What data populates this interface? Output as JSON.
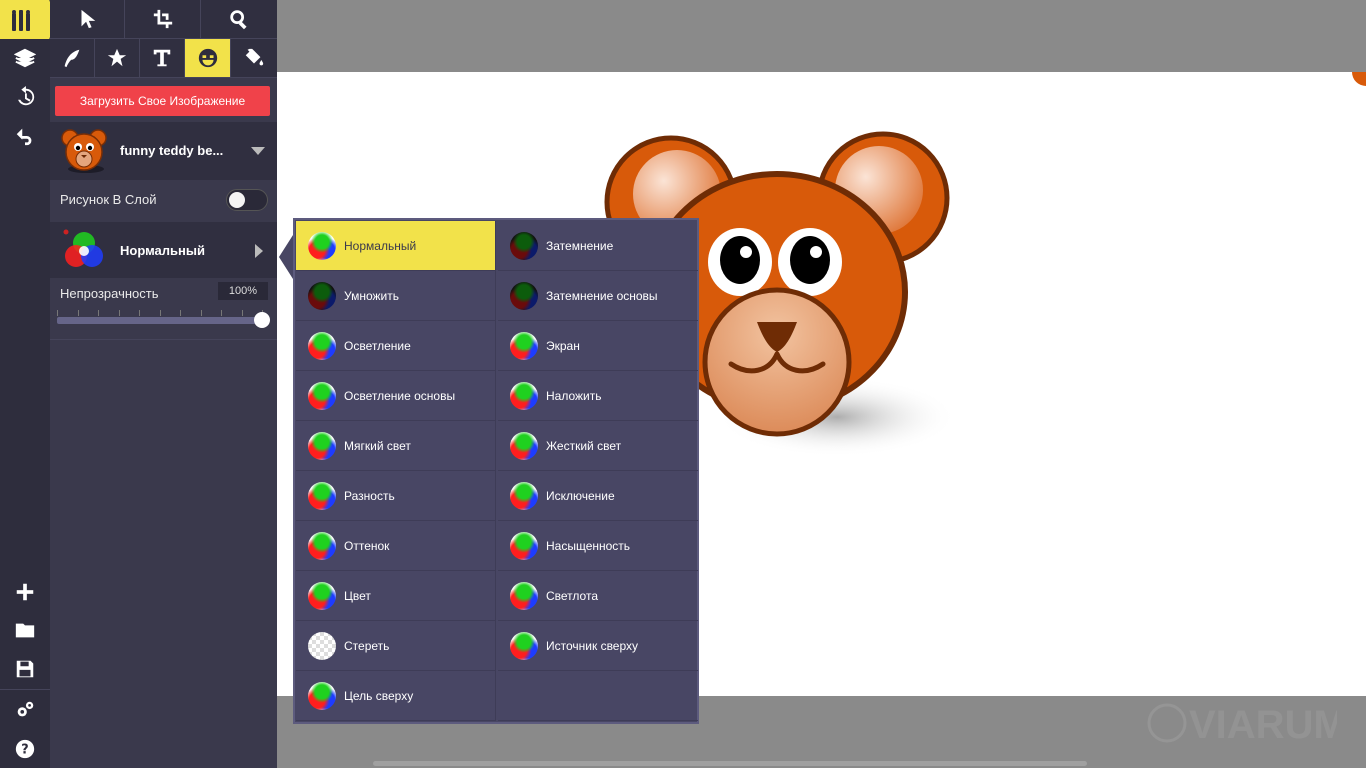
{
  "toolbar": {
    "tools_top": [
      "select-tool",
      "crop-tool",
      "zoom-tool"
    ],
    "tools_bottom": [
      "draw-tool",
      "shapes-tool",
      "text-tool",
      "stickers-tool",
      "fill-tool"
    ],
    "active_tool": "stickers-tool"
  },
  "panel": {
    "upload_label": "Загрузить Свое Изображение",
    "image_name": "funny teddy be...",
    "layer_label": "Рисунок В Слой",
    "blend_label": "Нормальный",
    "opacity_label": "Непрозрачность",
    "opacity_value": "100%",
    "opacity_level": 1.0
  },
  "blend_menu": {
    "items": [
      {
        "label": "Нормальный",
        "selected": true
      },
      {
        "label": "Затемнение"
      },
      {
        "label": "Умножить"
      },
      {
        "label": "Затемнение основы"
      },
      {
        "label": "Осветление"
      },
      {
        "label": "Экран"
      },
      {
        "label": "Осветление основы"
      },
      {
        "label": "Наложить"
      },
      {
        "label": "Мягкий свет"
      },
      {
        "label": "Жесткий свет"
      },
      {
        "label": "Разность"
      },
      {
        "label": "Исключение"
      },
      {
        "label": "Оттенок"
      },
      {
        "label": "Насыщенность"
      },
      {
        "label": "Цвет"
      },
      {
        "label": "Светлота"
      },
      {
        "label": "Стереть"
      },
      {
        "label": "Источник сверху"
      },
      {
        "label": "Цель сверху"
      }
    ]
  },
  "watermark": "VIARUM",
  "colors": {
    "accent": "#f2e24a",
    "upload_button": "#f0424a",
    "panel_bg": "#3a394c",
    "rail_bg": "#2e2d3d",
    "bear_orange": "#d85a0a"
  }
}
